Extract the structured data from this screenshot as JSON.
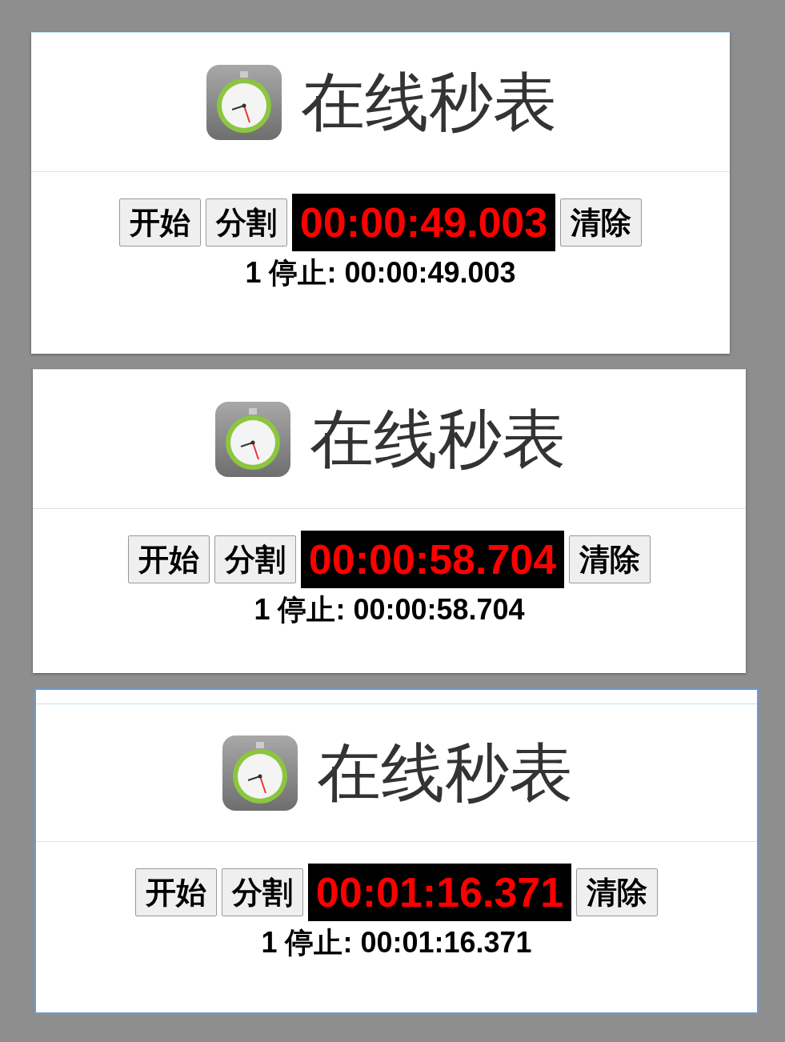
{
  "cards": [
    {
      "title": "在线秒表",
      "focused": false,
      "controls": [
        {
          "kind": "button",
          "text": "开始"
        },
        {
          "kind": "button",
          "text": "分割"
        },
        {
          "kind": "display",
          "text": "00:00:49.003"
        },
        {
          "kind": "button",
          "text": "清除"
        }
      ],
      "laps": [
        "1 停止: 00:00:49.003"
      ]
    },
    {
      "title": "在线秒表",
      "focused": false,
      "controls": [
        {
          "kind": "button",
          "text": "开始"
        },
        {
          "kind": "button",
          "text": "分割"
        },
        {
          "kind": "display",
          "text": "00:00:58.704"
        },
        {
          "kind": "button",
          "text": "清除"
        }
      ],
      "laps": [
        "1 停止: 00:00:58.704"
      ]
    },
    {
      "title": "在线秒表",
      "focused": true,
      "controls": [
        {
          "kind": "button",
          "text": "开始"
        },
        {
          "kind": "button",
          "text": "分割"
        },
        {
          "kind": "display",
          "text": "00:01:16.371"
        },
        {
          "kind": "button",
          "text": "清除"
        }
      ],
      "laps": [
        "1 停止: 00:01:16.371"
      ]
    }
  ]
}
